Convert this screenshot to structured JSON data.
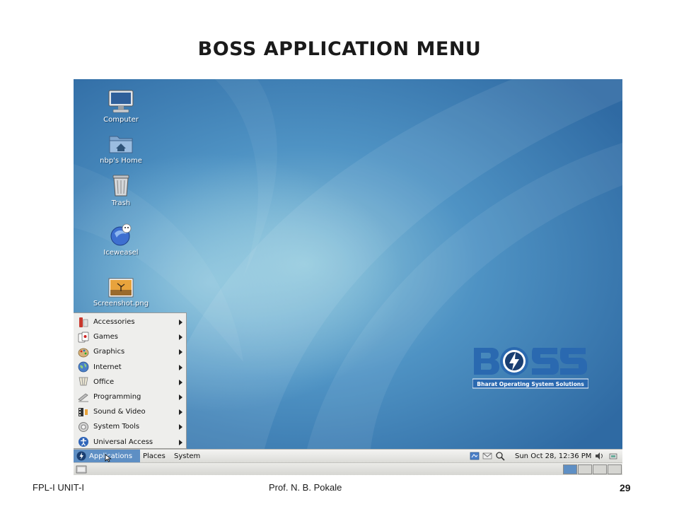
{
  "slide": {
    "title": "BOSS APPLICATION MENU",
    "footer_left": "FPL-I  UNIT-I",
    "footer_center": "Prof. N. B. Pokale",
    "page_number": "29"
  },
  "desktop": {
    "icons": [
      {
        "label": "Computer",
        "icon": "computer-icon"
      },
      {
        "label": "nbp's Home",
        "icon": "home-folder-icon"
      },
      {
        "label": "Trash",
        "icon": "trash-icon"
      },
      {
        "label": "Iceweasel",
        "icon": "iceweasel-icon"
      },
      {
        "label": "Screenshot.png",
        "icon": "image-file-icon"
      }
    ]
  },
  "app_menu": {
    "items": [
      {
        "label": "Accessories",
        "icon": "accessories-icon"
      },
      {
        "label": "Games",
        "icon": "games-icon"
      },
      {
        "label": "Graphics",
        "icon": "graphics-icon"
      },
      {
        "label": "Internet",
        "icon": "internet-icon"
      },
      {
        "label": "Office",
        "icon": "office-icon"
      },
      {
        "label": "Programming",
        "icon": "programming-icon"
      },
      {
        "label": "Sound & Video",
        "icon": "sound-video-icon"
      },
      {
        "label": "System Tools",
        "icon": "system-tools-icon"
      },
      {
        "label": "Universal Access",
        "icon": "universal-access-icon"
      }
    ]
  },
  "panel": {
    "applications": "Applications",
    "places": "Places",
    "system": "System",
    "clock": "Sun Oct 28, 12:36 PM"
  },
  "logo": {
    "tagline": "Bharat Operating System Solutions"
  },
  "colors": {
    "desktop_blue": "#3f7fb6",
    "panel_highlight": "#5e8fc4",
    "logo_blue": "#2a69b0"
  }
}
